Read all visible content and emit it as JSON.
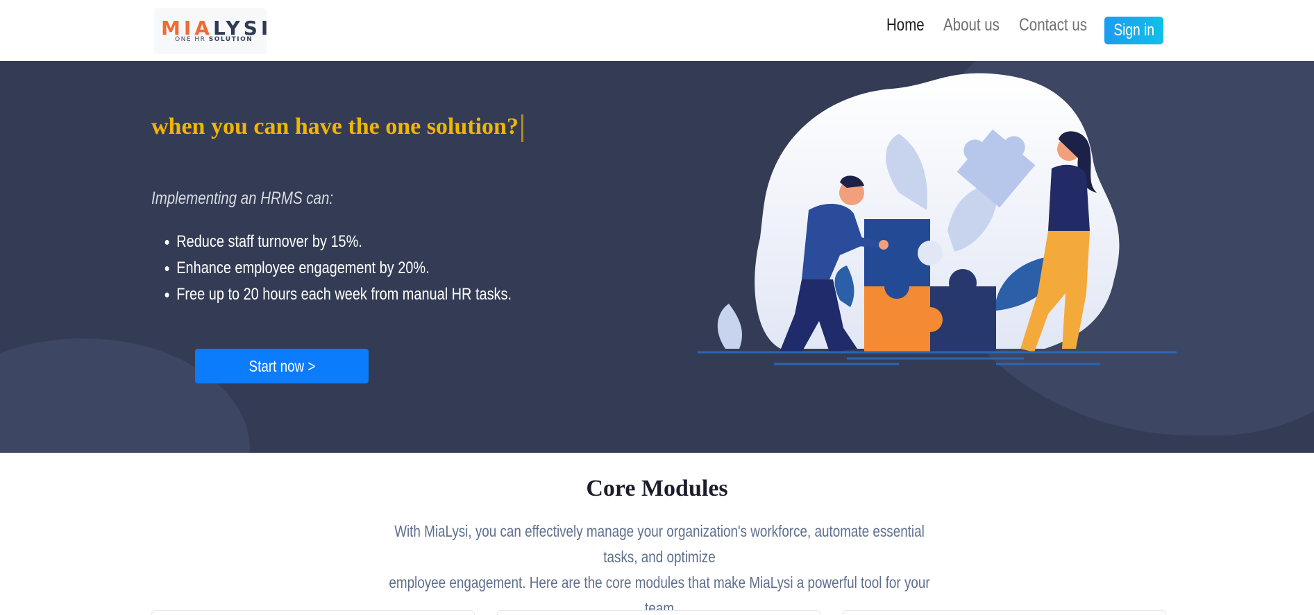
{
  "header": {
    "logo": {
      "word_orange": "MIA",
      "word_dark": "LYSI",
      "sub_thin": "ONE HR ",
      "sub_bold": "SOLUTION"
    },
    "nav": [
      {
        "label": "Home",
        "active": true
      },
      {
        "label": "About us",
        "active": false
      },
      {
        "label": "Contact us",
        "active": false
      }
    ],
    "signin_label": "Sign in"
  },
  "hero": {
    "headline": "when you can have the one solution?",
    "intro": "Implementing an HRMS can:",
    "bullets": [
      "Reduce staff turnover by 15%.",
      "Enhance employee engagement by 20%.",
      "Free up to 20 hours each week from manual HR tasks."
    ],
    "cta_label": "Start now >"
  },
  "core": {
    "title": "Core Modules",
    "desc_line1": "With MiaLysi, you can effectively manage your organization's workforce, automate essential tasks, and optimize",
    "desc_line2": "employee engagement. Here are the core modules that make MiaLysi a powerful tool for your team"
  },
  "colors": {
    "hero_bg": "#343c55",
    "headline": "#f4b400",
    "cta": "#0b7cfb",
    "signin_start": "#1e9bf0",
    "signin_end": "#0fc0e6",
    "puzzle_navy": "#234a94",
    "puzzle_orange": "#f48a33"
  }
}
